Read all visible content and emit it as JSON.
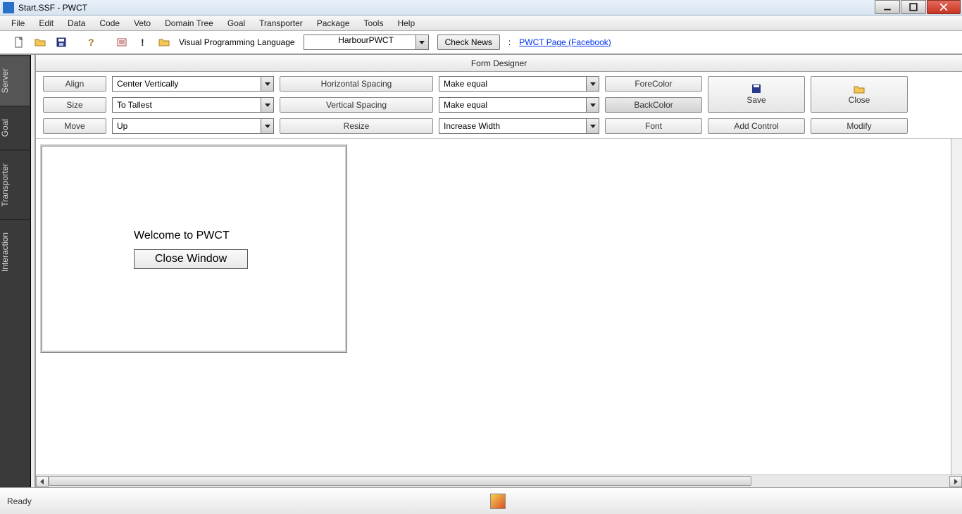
{
  "title": "Start.SSF  - PWCT",
  "menu": [
    "File",
    "Edit",
    "Data",
    "Code",
    "Veto",
    "Domain Tree",
    "Goal",
    "Transporter",
    "Package",
    "Tools",
    "Help"
  ],
  "toolbar": {
    "lang_label": "Visual Programming Language",
    "lang_value": "HarbourPWCT",
    "check_news": "Check News",
    "link_sep": ":",
    "link_text": "PWCT Page (Facebook)"
  },
  "side_tabs": [
    "Server",
    "Goal",
    "Transporter",
    "Interaction"
  ],
  "panel_title": "Form Designer",
  "design": {
    "r1": {
      "btn": "Align",
      "sel": "Center Vertically",
      "mid": "Horizontal Spacing",
      "sel2": "Make equal",
      "right": "ForeColor"
    },
    "r2": {
      "btn": "Size",
      "sel": "To Tallest",
      "mid": "Vertical Spacing",
      "sel2": "Make equal",
      "right": "BackColor"
    },
    "r3": {
      "btn": "Move",
      "sel": "Up",
      "mid": "Resize",
      "sel2": "Increase Width",
      "right": "Font"
    },
    "save": "Save",
    "close": "Close",
    "add_control": "Add Control",
    "modify": "Modify"
  },
  "form_preview": {
    "label": "Welcome to PWCT",
    "button": "Close Window"
  },
  "status": "Ready"
}
